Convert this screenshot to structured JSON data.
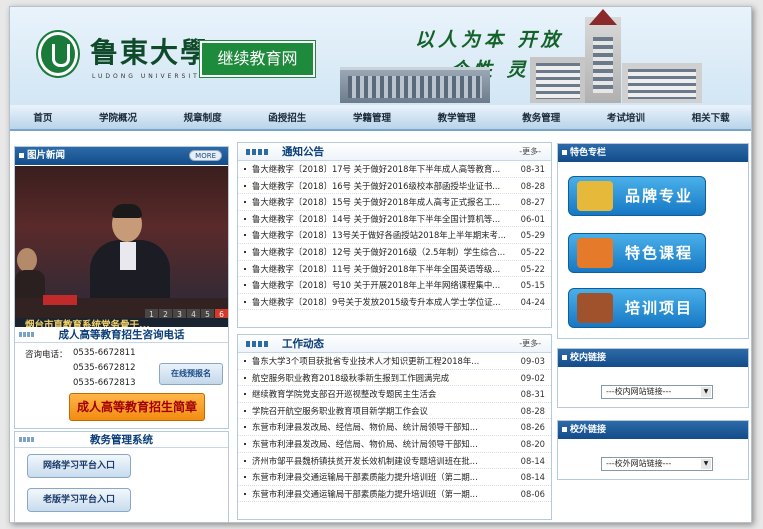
{
  "header": {
    "logo_cn": "鲁東大學",
    "logo_en": "LUDONG UNIVERSITY",
    "site_name": "继续教育网",
    "slogan_line1": "以人为本 开放",
    "slogan_line2": "个性 灵活 实用"
  },
  "nav": [
    "首页",
    "学院概况",
    "规章制度",
    "函授招生",
    "学籍管理",
    "教学管理",
    "教务管理",
    "考试培训",
    "相关下载"
  ],
  "photo_news": {
    "title": "图片新闻",
    "more": "MORE",
    "caption": "烟台市直教育系统党务骨干...",
    "pages": [
      "1",
      "2",
      "3",
      "4",
      "5",
      "6"
    ],
    "active_page": "6"
  },
  "consult": {
    "title": "成人高等教育招生咨询电话",
    "tel_label": "咨询电话：",
    "phones": [
      "0535-6672811",
      "0535-6672812",
      "0535-6672813"
    ],
    "register_button": "在线预报名",
    "brochure_button": "成人高等教育招生简章"
  },
  "teaching": {
    "title": "教务管理系统",
    "online_platform": "网络学习平台入口",
    "old_platform": "老版学习平台入口"
  },
  "notices": {
    "title": "通知公告",
    "more": "-更多-",
    "items": [
      {
        "text": "鲁大继教字〔2018〕17号 关于做好2018年下半年成人高等教育...",
        "date": "08-31"
      },
      {
        "text": "鲁大继教字〔2018〕16号 关于做好2016级校本部函授毕业证书...",
        "date": "08-28"
      },
      {
        "text": "鲁大继教字〔2018〕15号 关于做好2018年成人高考正式报名工...",
        "date": "08-27"
      },
      {
        "text": "鲁大继教字〔2018〕14号 关于做好2018年下半年全国计算机等...",
        "date": "06-01"
      },
      {
        "text": "鲁大继教字〔2018〕13号关于做好各函授站2018年上半年期末考...",
        "date": "05-29"
      },
      {
        "text": "鲁大继教字〔2018〕12号 关于做好2016级（2.5年制）学生综合...",
        "date": "05-22"
      },
      {
        "text": "鲁大继教字〔2018〕11号 关于做好2018年下半年全国英语等级...",
        "date": "05-22"
      },
      {
        "text": "鲁大继教字〔2018〕号10 关于开展2018年上半年网络课程集中...",
        "date": "05-15"
      },
      {
        "text": "鲁大继教字〔2018〕9号关于发放2015级专升本成人学士学位证...",
        "date": "04-24"
      }
    ]
  },
  "work": {
    "title": "工作动态",
    "more": "-更多-",
    "items": [
      {
        "text": "鲁东大学3个项目获批省专业技术人才知识更新工程2018年...",
        "date": "09-03"
      },
      {
        "text": "航空服务职业教育2018级秋季新生报到工作圆满完成",
        "date": "09-02"
      },
      {
        "text": "继续教育学院党支部召开巡视整改专题民主生活会",
        "date": "08-31"
      },
      {
        "text": "学院召开航空服务职业教育项目新学期工作会议",
        "date": "08-28"
      },
      {
        "text": "东营市利津县发改局、经信局、物价局、统计局领导干部知...",
        "date": "08-26"
      },
      {
        "text": "东营市利津县发改局、经信局、物价局、统计局领导干部知...",
        "date": "08-20"
      },
      {
        "text": "济州市邹平县魏桥镇扶贫开发长效机制建设专题培训班在批...",
        "date": "08-14"
      },
      {
        "text": "东营市利津县交通运输局干部素质能力提升培训班（第二期...",
        "date": "08-14"
      },
      {
        "text": "东营市利津县交通运输局干部素质能力提升培训班（第一期...",
        "date": "08-06"
      }
    ]
  },
  "special": {
    "title": "特色专栏",
    "items": [
      "品牌专业",
      "特色课程",
      "培训项目"
    ],
    "colors": [
      "#e6b93a",
      "#e57a2a",
      "#a0522d"
    ]
  },
  "inner_links": {
    "title": "校内链接",
    "select": "---校内网站链接---"
  },
  "outer_links": {
    "title": "校外链接",
    "select": "---校外网站链接---"
  }
}
